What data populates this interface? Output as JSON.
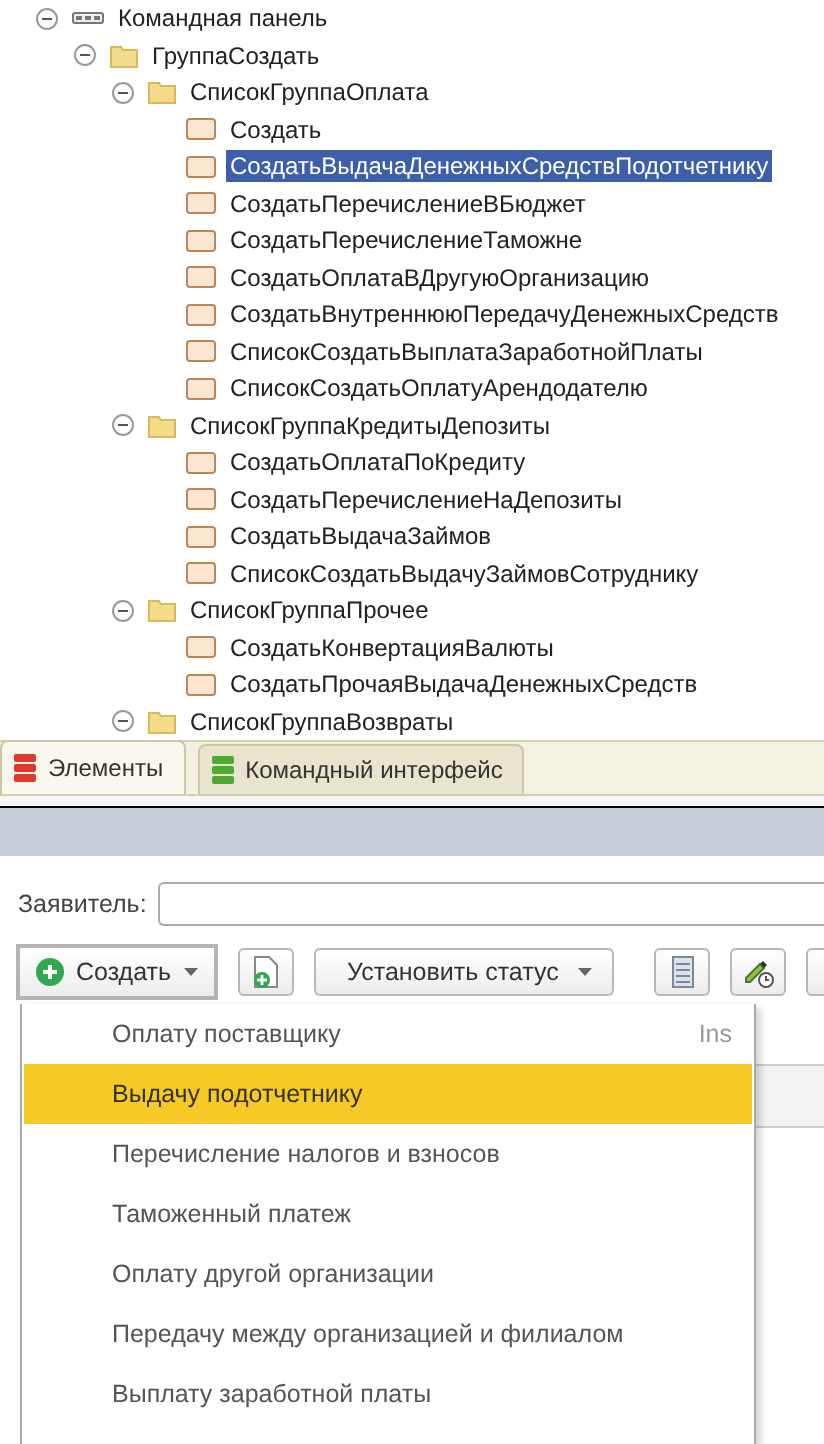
{
  "tree": [
    {
      "label": "Командная панель",
      "kind": "panel",
      "expanded": true,
      "children": [
        {
          "label": "ГруппаСоздать",
          "kind": "group",
          "expanded": true,
          "children": [
            {
              "label": "СписокГруппаОплата",
              "kind": "group",
              "expanded": true,
              "children": [
                {
                  "label": "Создать",
                  "kind": "command",
                  "selected": false
                },
                {
                  "label": "СоздатьВыдачаДенежныхСредствПодотчетнику",
                  "kind": "command",
                  "selected": true
                },
                {
                  "label": "СоздатьПеречислениеВБюджет",
                  "kind": "command",
                  "selected": false
                },
                {
                  "label": "СоздатьПеречислениеТаможне",
                  "kind": "command",
                  "selected": false
                },
                {
                  "label": "СоздатьОплатаВДругуюОрганизацию",
                  "kind": "command",
                  "selected": false
                },
                {
                  "label": "СоздатьВнутреннююПередачуДенежныхСредств",
                  "kind": "command",
                  "selected": false
                },
                {
                  "label": "СписокСоздатьВыплатаЗаработнойПлаты",
                  "kind": "command",
                  "selected": false
                },
                {
                  "label": "СписокСоздатьОплатуАрендодателю",
                  "kind": "command",
                  "selected": false
                }
              ]
            },
            {
              "label": "СписокГруппаКредитыДепозиты",
              "kind": "group",
              "expanded": true,
              "children": [
                {
                  "label": "СоздатьОплатаПоКредиту",
                  "kind": "command",
                  "selected": false
                },
                {
                  "label": "СоздатьПеречислениеНаДепозиты",
                  "kind": "command",
                  "selected": false
                },
                {
                  "label": "СоздатьВыдачаЗаймов",
                  "kind": "command",
                  "selected": false
                },
                {
                  "label": "СписокСоздатьВыдачуЗаймовСотруднику",
                  "kind": "command",
                  "selected": false
                }
              ]
            },
            {
              "label": "СписокГруппаПрочее",
              "kind": "group",
              "expanded": true,
              "children": [
                {
                  "label": "СоздатьКонвертацияВалюты",
                  "kind": "command",
                  "selected": false
                },
                {
                  "label": "СоздатьПрочаяВыдачаДенежныхСредств",
                  "kind": "command",
                  "selected": false
                }
              ]
            },
            {
              "label": "СписокГруппаВозвраты",
              "kind": "group",
              "expanded": true
            }
          ]
        }
      ]
    }
  ],
  "tabs": [
    {
      "label": "Элементы",
      "selected": true,
      "color": "#e0382c"
    },
    {
      "label": "Командный интерфейс",
      "selected": false,
      "color": "#4caa2e"
    }
  ],
  "form": {
    "applicant_label": "Заявитель:"
  },
  "toolbar": {
    "create_button": "Создать",
    "status_button": "Установить статус"
  },
  "menu": [
    {
      "label": "Оплату поставщику",
      "shortcut": "Ins",
      "selected": false
    },
    {
      "label": "Выдачу подотчетнику",
      "selected": true
    },
    {
      "label": "Перечисление налогов и взносов",
      "selected": false
    },
    {
      "label": "Таможенный платеж",
      "selected": false
    },
    {
      "label": "Оплату другой организации",
      "selected": false
    },
    {
      "label": "Передачу между организацией и филиалом",
      "selected": false
    },
    {
      "label": "Выплату заработной платы",
      "selected": false
    }
  ]
}
